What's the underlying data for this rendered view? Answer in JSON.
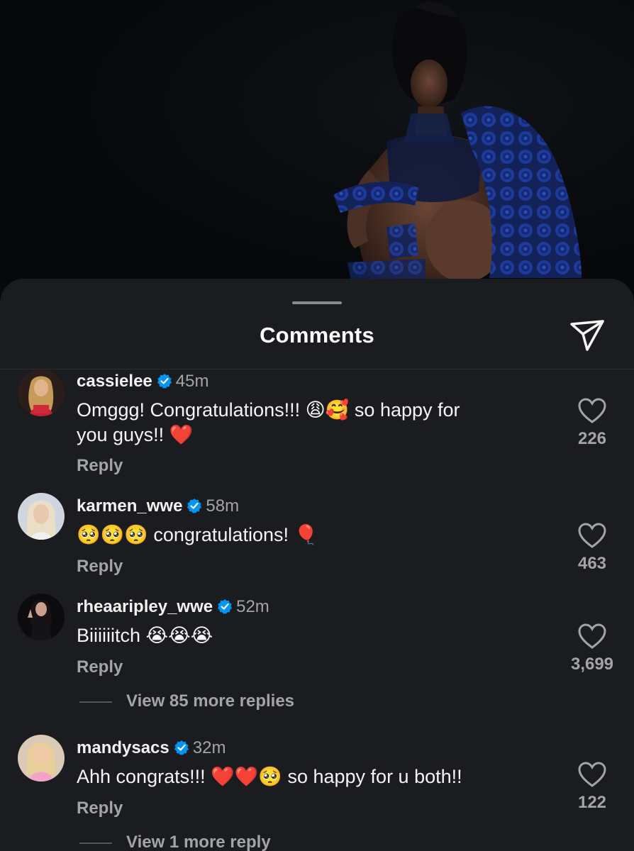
{
  "sheet": {
    "title": "Comments",
    "share_icon": "send-icon"
  },
  "colors": {
    "sheet_background": "#1b1c1f",
    "verified_blue": "#0095f6",
    "secondary_text": "#a3a4a8"
  },
  "comments": [
    {
      "username": "cassielee",
      "verified": true,
      "time": "45m",
      "text_line1": "Omggg! Congratulations!!! 😩🥰 so happy for",
      "text_line2": "you guys!! ❤️",
      "reply_label": "Reply",
      "likes": "226"
    },
    {
      "username": "karmen_wwe",
      "verified": true,
      "time": "58m",
      "text_line1": "🥺🥺🥺 congratulations! 🎈",
      "reply_label": "Reply",
      "likes": "463"
    },
    {
      "username": "rheaaripley_wwe",
      "verified": true,
      "time": "52m",
      "text_line1": "Biiiiiitch 😭😭😭",
      "reply_label": "Reply",
      "likes": "3,699",
      "view_replies": "View 85 more replies"
    },
    {
      "username": "mandysacs",
      "verified": true,
      "time": "32m",
      "text_line1": "Ahh congrats!!! ❤️❤️🥺 so happy for u both!!",
      "reply_label": "Reply",
      "likes": "122",
      "view_replies": "View 1 more reply"
    }
  ]
}
